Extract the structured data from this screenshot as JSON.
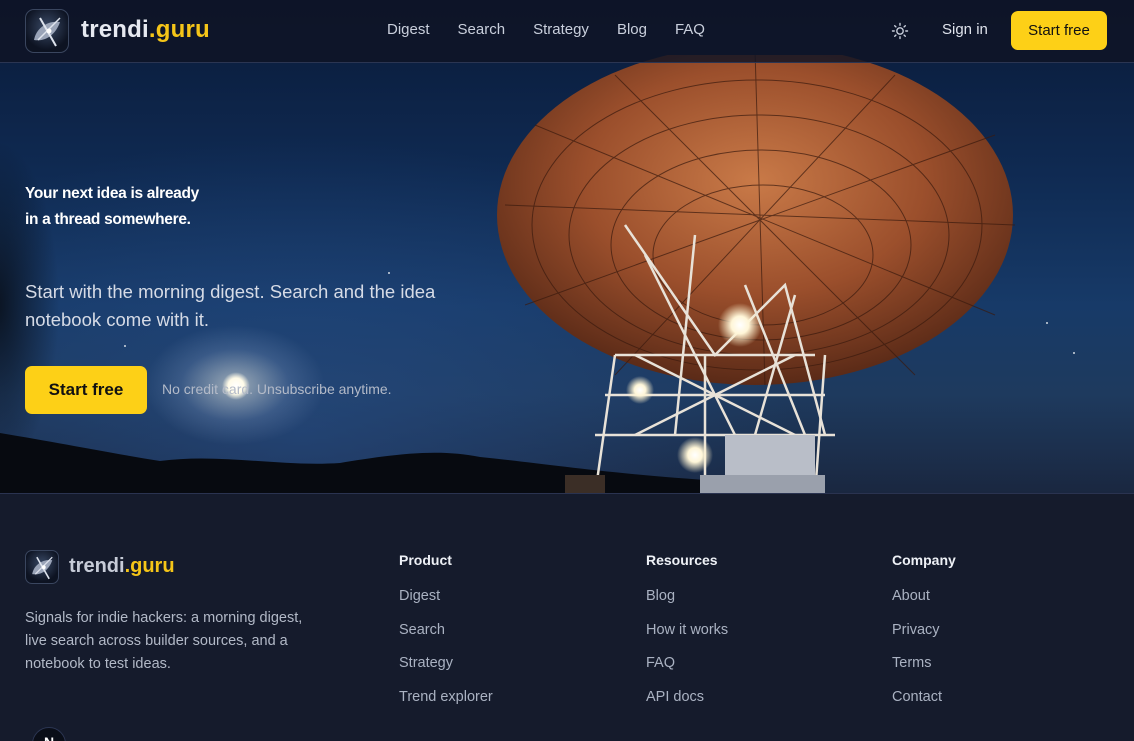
{
  "nav": {
    "brand_part1": "trendi",
    "brand_part2": ".guru",
    "links": [
      "Digest",
      "Search",
      "Strategy",
      "Blog",
      "FAQ"
    ],
    "theme_icon": "sun-icon",
    "signin_label": "Sign in",
    "cta_label": "Start free"
  },
  "hero": {
    "title": "Your next idea is already in a thread somewhere.",
    "subtitle": "Start with the morning digest. Search and the idea notebook come with it.",
    "cta_label": "Start free",
    "note": "No credit card. Unsubscribe anytime."
  },
  "footer": {
    "brand_part1": "trendi",
    "brand_part2": ".guru",
    "description": "Signals for indie hackers: a morning digest, live search across builder sources, and a notebook to test ideas.",
    "columns": [
      {
        "title": "Product",
        "links": [
          "Digest",
          "Search",
          "Strategy",
          "Trend explorer"
        ]
      },
      {
        "title": "Resources",
        "links": [
          "Blog",
          "How it works",
          "FAQ",
          "API docs"
        ]
      },
      {
        "title": "Company",
        "links": [
          "About",
          "Privacy",
          "Terms",
          "Contact"
        ]
      }
    ],
    "avatar_letter": "N"
  },
  "colors": {
    "accent": "#fdd017",
    "background": "#151b2c",
    "nav_bg": "#0f1424"
  }
}
